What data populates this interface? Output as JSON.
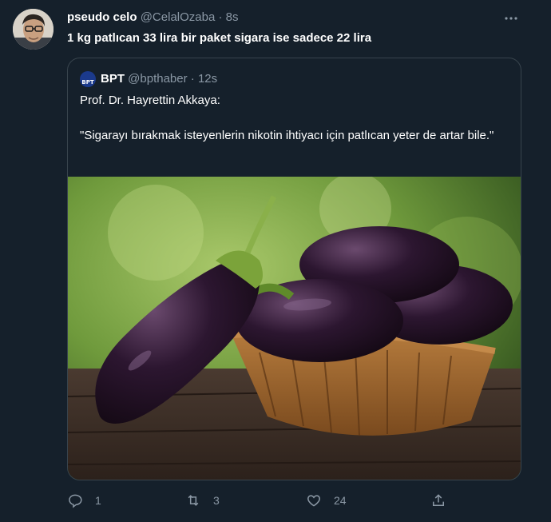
{
  "tweet": {
    "author_name": "pseudo celo",
    "author_handle": "@CelalOzaba",
    "separator": "·",
    "time": "8s",
    "text": "1 kg patlıcan 33 lira bir paket sigara ise sadece 22 lira"
  },
  "quote": {
    "logo_text": "BPT",
    "author_name": "BPT",
    "author_handle": "@bpthaber",
    "separator": "·",
    "time": "12s",
    "line1": "Prof. Dr. Hayrettin Akkaya:",
    "line2": "\"Sigarayı bırakmak isteyenlerin nikotin ihtiyacı için patlıcan yeter de artar bile.\""
  },
  "actions": {
    "reply_count": "1",
    "retweet_count": "3",
    "like_count": "24"
  },
  "icons": [
    "more-icon",
    "reply-icon",
    "retweet-icon",
    "like-icon",
    "share-icon"
  ],
  "colors": {
    "background": "#15202b",
    "border": "#38444d",
    "muted_text": "#8b98a5"
  }
}
